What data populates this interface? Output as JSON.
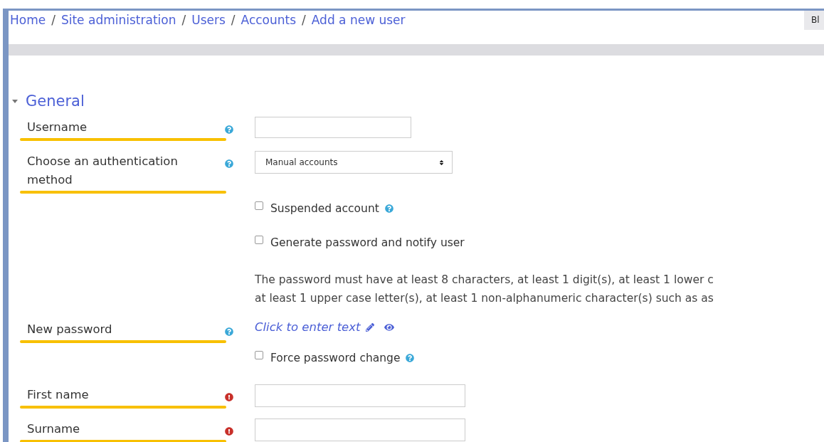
{
  "breadcrumb": [
    "Home",
    "Site administration",
    "Users",
    "Accounts",
    "Add a new user"
  ],
  "breadcrumb_separator": "/",
  "header_button": "Bl",
  "section": {
    "title": "General",
    "expanded": true
  },
  "rows": [
    {
      "kind": "text",
      "label": "Username",
      "help": true,
      "underlined": true,
      "value": ""
    },
    {
      "kind": "select",
      "label": "Choose an authentication method",
      "help": true,
      "underlined": true,
      "value": "Manual accounts"
    },
    {
      "kind": "checkbox",
      "text": "Suspended account",
      "help": true,
      "checked": false
    },
    {
      "kind": "checkbox",
      "text": "Generate password and notify user",
      "checked": false
    },
    {
      "kind": "note",
      "lines": [
        "The password must have at least 8 characters, at least 1 digit(s), at least 1 lower c",
        "at least 1 upper case letter(s), at least 1 non-alphanumeric character(s) such as as"
      ]
    },
    {
      "kind": "password",
      "label": "New password",
      "help": true,
      "underlined": true,
      "value": "Click to enter text"
    },
    {
      "kind": "checkbox",
      "text": "Force password change",
      "help": true,
      "checked": false
    },
    {
      "kind": "text",
      "label": "First name",
      "required": true,
      "underlined": true,
      "value": ""
    },
    {
      "kind": "text",
      "label": "Surname",
      "required": true,
      "underlined": true,
      "value": ""
    }
  ]
}
